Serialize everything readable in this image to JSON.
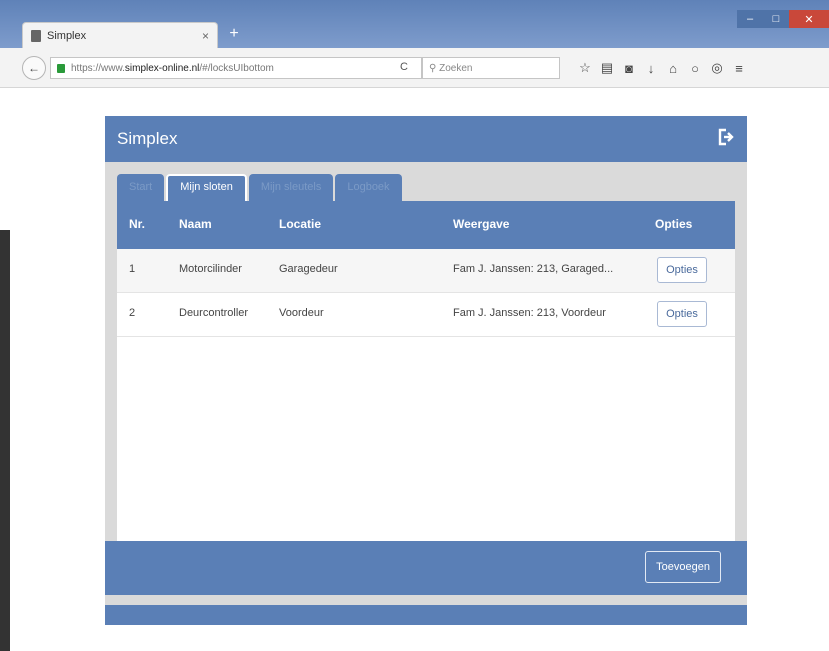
{
  "browser": {
    "tab_title": "Simplex",
    "tab_close": "×",
    "new_tab": "+",
    "url_prefix": "https://www.",
    "url_domain": "simplex-online.nl",
    "url_path": "/#/locksUIbottom",
    "search_placeholder": "Zoeken",
    "icons": [
      "star-icon",
      "library-icon",
      "pocket-icon",
      "download-icon",
      "home-icon",
      "chat-icon",
      "extension-icon",
      "menu-icon"
    ]
  },
  "app": {
    "title": "Simplex",
    "accent": "#5a7fb6",
    "tabs": [
      {
        "label": "Start",
        "active": false
      },
      {
        "label": "Mijn sloten",
        "active": true
      },
      {
        "label": "Mijn sleutels",
        "active": false
      },
      {
        "label": "Logboek",
        "active": false
      }
    ],
    "table": {
      "columns": [
        "Nr.",
        "Naam",
        "Locatie",
        "Weergave",
        "Opties"
      ],
      "rows": [
        {
          "nr": "1",
          "naam": "Motorcilinder",
          "locatie": "Garagedeur",
          "weergave": "Fam J. Janssen: 213, Garaged...",
          "opties": "Opties"
        },
        {
          "nr": "2",
          "naam": "Deurcontroller",
          "locatie": "Voordeur",
          "weergave": "Fam J. Janssen: 213, Voordeur",
          "opties": "Opties"
        }
      ]
    },
    "add_button": "Toevoegen"
  }
}
